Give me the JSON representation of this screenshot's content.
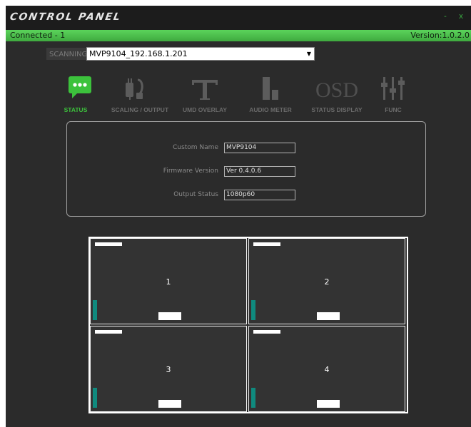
{
  "app": {
    "title": "CONTROL PANEL",
    "minimize_glyph": "-",
    "close_glyph": "x"
  },
  "statusbar": {
    "connection": "Connected - 1",
    "version": "Version:1.0.2.0"
  },
  "scan": {
    "label": "SCANNING",
    "selected_device": "MVP9104_192.168.1.201"
  },
  "toolbar": {
    "items": [
      {
        "label": "STATUS",
        "icon": "chat-bubble-icon",
        "active": true
      },
      {
        "label": "SCALING / OUTPUT",
        "icon": "plug-icon",
        "active": false
      },
      {
        "label": "UMD OVERLAY",
        "icon": "text-t-icon",
        "active": false
      },
      {
        "label": "AUDIO METER",
        "icon": "bar-meter-icon",
        "active": false
      },
      {
        "label": "STATUS DISPLAY",
        "icon": "osd-icon",
        "active": false
      },
      {
        "label": "FUNC",
        "icon": "sliders-icon",
        "active": false
      }
    ],
    "osd_icon_text": "OSD"
  },
  "status": {
    "custom_name": {
      "label": "Custom Name",
      "value": "MVP9104"
    },
    "firmware_version": {
      "label": "Firmware Version",
      "value": "Ver 0.4.0.6"
    },
    "output_status": {
      "label": "Output Status",
      "value": "1080p60"
    }
  },
  "windows": [
    {
      "number": "1"
    },
    {
      "number": "2"
    },
    {
      "number": "3"
    },
    {
      "number": "4"
    }
  ],
  "colors": {
    "accent_green": "#3cc23c",
    "status_bar": "#4cbf4c",
    "meter_teal": "#0f8a7e",
    "background": "#2b2b2b"
  }
}
